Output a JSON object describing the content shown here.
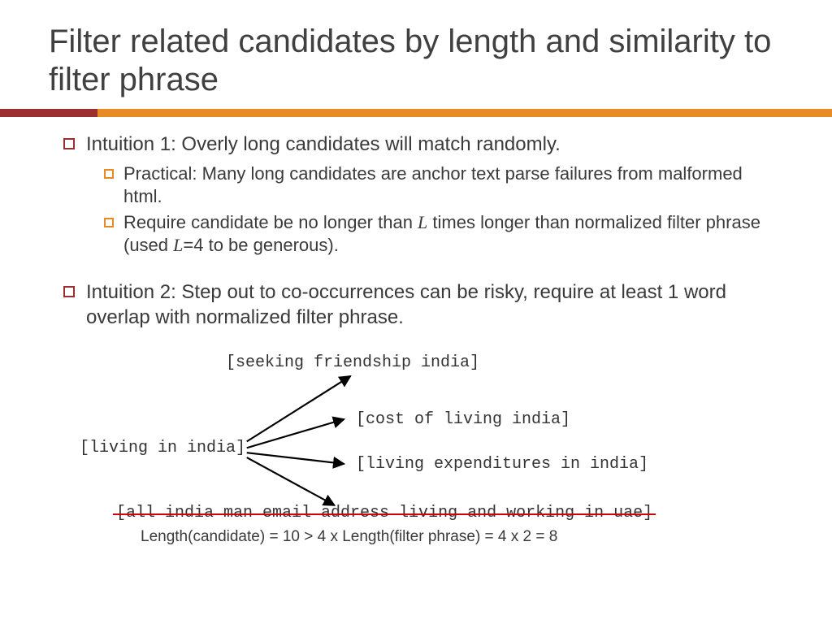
{
  "title": "Filter related candidates by length and similarity to filter phrase",
  "bullets": {
    "i1": "Intuition 1: Overly long candidates will match randomly.",
    "i1a": "Practical: Many long candidates are anchor text parse failures from malformed html.",
    "i1b_pre": "Require candidate be no longer than ",
    "i1b_L1": "L",
    "i1b_mid": " times longer than normalized filter phrase (used ",
    "i1b_L2": "L",
    "i1b_eq": "=4 to be generous).",
    "i2": "Intuition 2: Step out to co-occurrences can be risky, require at least 1 word overlap with normalized filter phrase."
  },
  "diagram": {
    "seed": "[living in india]",
    "cand1": "[seeking friendship india]",
    "cand2": "[cost of living india]",
    "cand3": "[living expenditures in india]",
    "cand4": "[all india man email address living and working in uae]",
    "caption": "Length(candidate) = 10 > 4 x Length(filter phrase) = 4 x 2 = 8"
  }
}
